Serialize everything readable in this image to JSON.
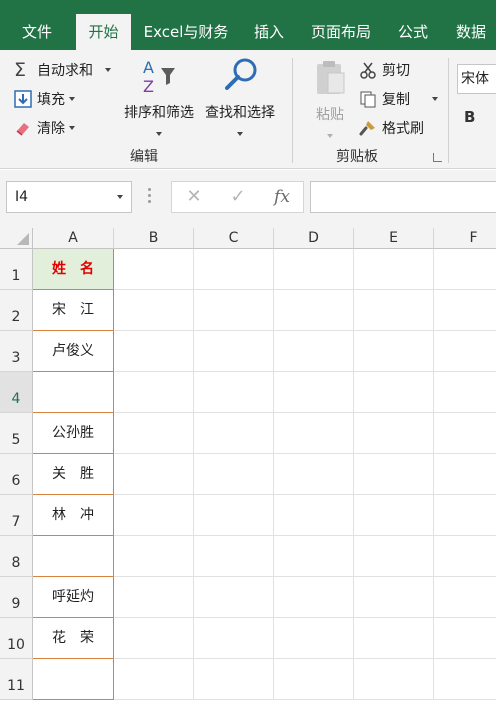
{
  "tabs": [
    {
      "label": "文件",
      "active": false
    },
    {
      "label": "开始",
      "active": true
    },
    {
      "label": "Excel与财务",
      "active": false
    },
    {
      "label": "插入",
      "active": false
    },
    {
      "label": "页面布局",
      "active": false
    },
    {
      "label": "公式",
      "active": false
    },
    {
      "label": "数据",
      "active": false
    }
  ],
  "ribbon": {
    "editing": {
      "autosum": "自动求和",
      "fill": "填充",
      "clear": "清除",
      "sort_filter": "排序和筛选",
      "find_select": "查找和选择",
      "group_label": "编辑"
    },
    "clipboard": {
      "paste": "粘贴",
      "cut": "剪切",
      "copy": "复制",
      "format_painter": "格式刷",
      "group_label": "剪贴板"
    },
    "font": {
      "font_name": "宋体",
      "bold": "B"
    },
    "colors": {
      "accent": "#217346",
      "header_fill": "#e2efda",
      "header_text": "#e00000",
      "border_orange": "#d8823b"
    }
  },
  "formula_bar": {
    "name_box": "I4",
    "cancel_icon": "✕",
    "enter_icon": "✓",
    "fx_label": "fx",
    "formula": ""
  },
  "grid": {
    "columns": [
      "A",
      "B",
      "C",
      "D",
      "E",
      "F"
    ],
    "rows": [
      "1",
      "2",
      "3",
      "4",
      "5",
      "6",
      "7",
      "8",
      "9",
      "10",
      "11"
    ],
    "column_a": [
      "姓　名",
      "宋　江",
      "卢俊义",
      "",
      "公孙胜",
      "关　胜",
      "林　冲",
      "",
      "呼延灼",
      "花　荣",
      ""
    ],
    "active_row": "4"
  }
}
